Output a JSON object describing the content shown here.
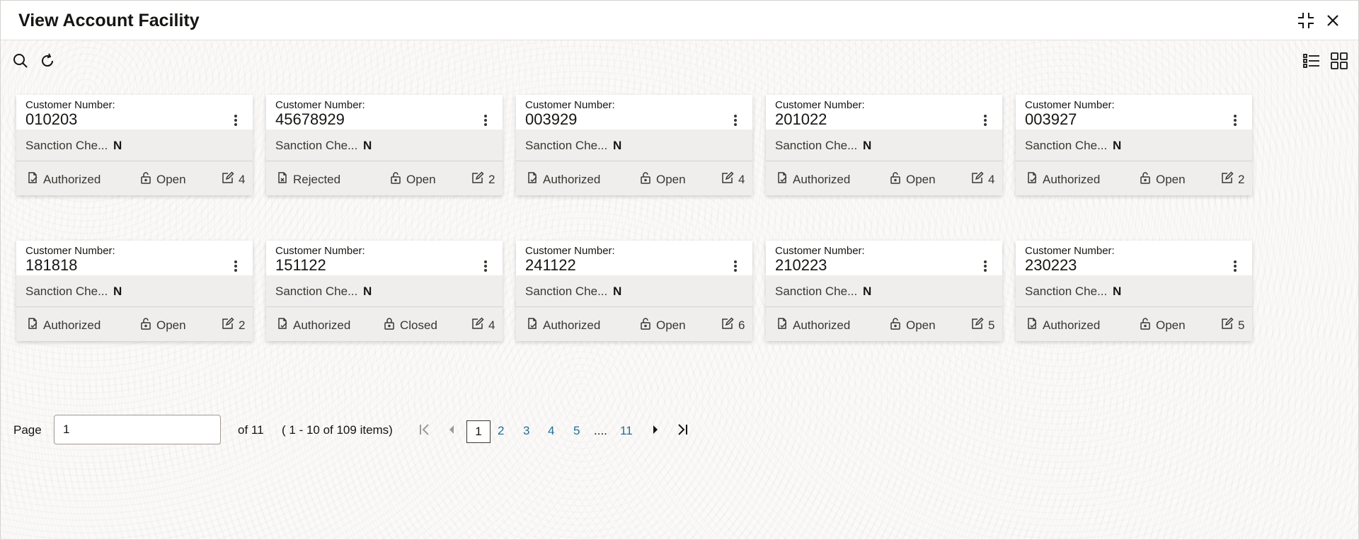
{
  "header": {
    "title": "View Account Facility"
  },
  "cards": [
    {
      "label": "Customer Number:",
      "number": "010203",
      "sanction_label": "Sanction Che...",
      "sanction_value": "N",
      "status": "Authorized",
      "state": "Open",
      "edits": "4"
    },
    {
      "label": "Customer Number:",
      "number": "45678929",
      "sanction_label": "Sanction Che...",
      "sanction_value": "N",
      "status": "Rejected",
      "state": "Open",
      "edits": "2"
    },
    {
      "label": "Customer Number:",
      "number": "003929",
      "sanction_label": "Sanction Che...",
      "sanction_value": "N",
      "status": "Authorized",
      "state": "Open",
      "edits": "4"
    },
    {
      "label": "Customer Number:",
      "number": "201022",
      "sanction_label": "Sanction Che...",
      "sanction_value": "N",
      "status": "Authorized",
      "state": "Open",
      "edits": "4"
    },
    {
      "label": "Customer Number:",
      "number": "003927",
      "sanction_label": "Sanction Che...",
      "sanction_value": "N",
      "status": "Authorized",
      "state": "Open",
      "edits": "2"
    },
    {
      "label": "Customer Number:",
      "number": "181818",
      "sanction_label": "Sanction Che...",
      "sanction_value": "N",
      "status": "Authorized",
      "state": "Open",
      "edits": "2"
    },
    {
      "label": "Customer Number:",
      "number": "151122",
      "sanction_label": "Sanction Che...",
      "sanction_value": "N",
      "status": "Authorized",
      "state": "Closed",
      "edits": "4"
    },
    {
      "label": "Customer Number:",
      "number": "241122",
      "sanction_label": "Sanction Che...",
      "sanction_value": "N",
      "status": "Authorized",
      "state": "Open",
      "edits": "6"
    },
    {
      "label": "Customer Number:",
      "number": "210223",
      "sanction_label": "Sanction Che...",
      "sanction_value": "N",
      "status": "Authorized",
      "state": "Open",
      "edits": "5"
    },
    {
      "label": "Customer Number:",
      "number": "230223",
      "sanction_label": "Sanction Che...",
      "sanction_value": "N",
      "status": "Authorized",
      "state": "Open",
      "edits": "5"
    }
  ],
  "pagination": {
    "page_label": "Page",
    "page_value": "1",
    "of_label": "of 11",
    "items_label": "( 1 - 10 of 109 items)",
    "current": "1",
    "pages": [
      "2",
      "3",
      "4",
      "5"
    ],
    "ellipsis": "....",
    "last": "11"
  },
  "icons": {
    "search": "search-icon",
    "refresh": "refresh-icon",
    "minimize": "minimize-icon",
    "close": "close-icon",
    "list_view": "list-view-icon",
    "grid_view": "grid-view-icon"
  },
  "colors": {
    "link": "#227095",
    "card_footer": "#efeeec"
  }
}
